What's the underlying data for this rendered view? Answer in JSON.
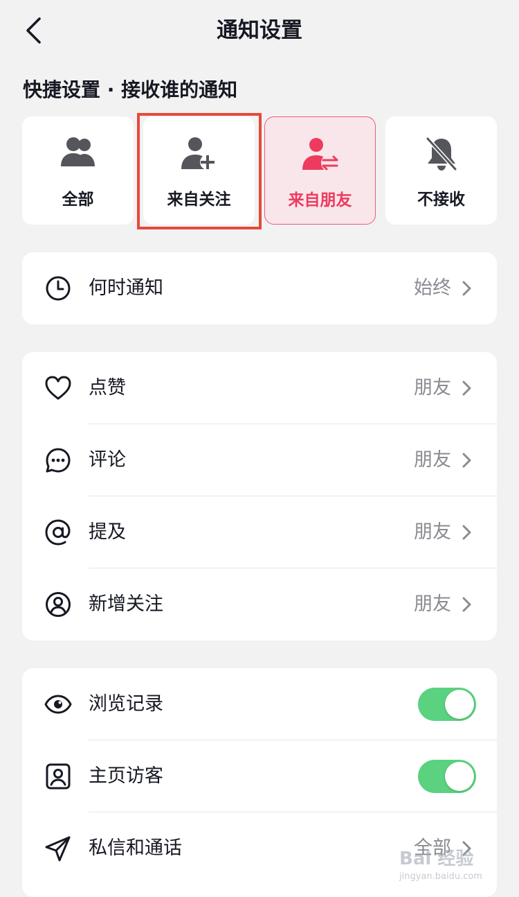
{
  "header": {
    "title": "通知设置"
  },
  "quick_settings": {
    "section_title": "快捷设置 · 接收谁的通知",
    "options": [
      {
        "label": "全部",
        "icon": "users-icon",
        "selected": false
      },
      {
        "label": "来自关注",
        "icon": "user-add-icon",
        "selected": false,
        "highlighted": true
      },
      {
        "label": "来自朋友",
        "icon": "user-exchange-icon",
        "selected": true
      },
      {
        "label": "不接收",
        "icon": "bell-off-icon",
        "selected": false
      }
    ]
  },
  "when_notify": {
    "label": "何时通知",
    "value": "始终",
    "icon": "clock-icon"
  },
  "interactions": [
    {
      "label": "点赞",
      "value": "朋友",
      "icon": "heart-icon"
    },
    {
      "label": "评论",
      "value": "朋友",
      "icon": "comment-icon"
    },
    {
      "label": "提及",
      "value": "朋友",
      "icon": "at-icon"
    },
    {
      "label": "新增关注",
      "value": "朋友",
      "icon": "user-circle-icon"
    }
  ],
  "privacy": {
    "browse_history": {
      "label": "浏览记录",
      "icon": "eye-icon",
      "enabled": true
    },
    "profile_visitors": {
      "label": "主页访客",
      "icon": "portrait-icon",
      "enabled": true
    },
    "messages_calls": {
      "label": "私信和通话",
      "value": "全部",
      "icon": "send-icon"
    }
  },
  "colors": {
    "accent": "#ee3a5e",
    "toggle_on": "#5ad27f",
    "highlight": "#e6493a",
    "background": "#f2f2f2"
  },
  "watermark": {
    "text": "Bai 经验",
    "sub": "jingyan.baidu.com"
  }
}
